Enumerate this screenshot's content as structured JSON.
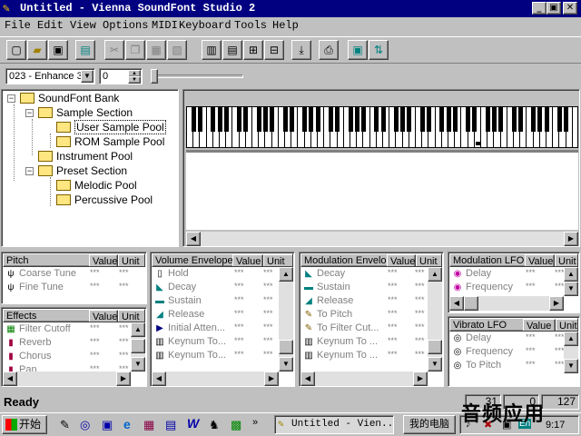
{
  "window": {
    "title": "Untitled - Vienna SoundFont Studio 2"
  },
  "menu": [
    "File",
    "Edit",
    "View",
    "Options",
    "MIDI",
    "Keyboard",
    "Tools",
    "Help"
  ],
  "controls": {
    "preset_select": "023 - Enhance 3",
    "bank_value": "0"
  },
  "tree": {
    "root": "SoundFont Bank",
    "sample_section": "Sample Section",
    "user_pool": "User Sample Pool",
    "rom_pool": "ROM Sample Pool",
    "instrument_pool": "Instrument Pool",
    "preset_section": "Preset Section",
    "melodic_pool": "Melodic Pool",
    "percussive_pool": "Percussive Pool"
  },
  "panels": {
    "pitch": {
      "title": "Pitch",
      "value": "Value",
      "unit": "Unit",
      "rows": [
        {
          "name": "Coarse Tune",
          "icon": "tuning-fork-icon",
          "value": "***",
          "unit": "***"
        },
        {
          "name": "Fine Tune",
          "icon": "tuning-fork-icon",
          "value": "***",
          "unit": "***"
        }
      ]
    },
    "effects": {
      "title": "Effects",
      "value": "Value",
      "unit": "Unit",
      "rows": [
        {
          "name": "Filter Cutoff",
          "icon": "filter-icon",
          "value": "***",
          "unit": "***"
        },
        {
          "name": "Reverb",
          "icon": "reverb-icon",
          "value": "***",
          "unit": "***"
        },
        {
          "name": "Chorus",
          "icon": "chorus-icon",
          "value": "***",
          "unit": "***"
        },
        {
          "name": "Pan",
          "icon": "pan-icon",
          "value": "***",
          "unit": "***"
        }
      ]
    },
    "volume_env": {
      "title": "Volume Envelope",
      "value": "Value",
      "unit": "Unit",
      "rows": [
        {
          "name": "Hold",
          "icon": "hold-icon",
          "value": "***",
          "unit": "***"
        },
        {
          "name": "Decay",
          "icon": "decay-icon",
          "value": "***",
          "unit": "***"
        },
        {
          "name": "Sustain",
          "icon": "sustain-icon",
          "value": "***",
          "unit": "***"
        },
        {
          "name": "Release",
          "icon": "release-icon",
          "value": "***",
          "unit": "***"
        },
        {
          "name": "Initial Atten...",
          "icon": "attenuation-icon",
          "value": "***",
          "unit": "***"
        },
        {
          "name": "Keynum To...",
          "icon": "keynum-icon",
          "value": "***",
          "unit": "***"
        },
        {
          "name": "Keynum To...",
          "icon": "keynum-icon",
          "value": "***",
          "unit": "***"
        }
      ]
    },
    "mod_env": {
      "title": "Modulation Envelo",
      "value": "Value",
      "unit": "Unit",
      "rows": [
        {
          "name": "Decay",
          "icon": "decay-icon",
          "value": "***",
          "unit": "***"
        },
        {
          "name": "Sustain",
          "icon": "sustain-icon",
          "value": "***",
          "unit": "***"
        },
        {
          "name": "Release",
          "icon": "release-icon",
          "value": "***",
          "unit": "***"
        },
        {
          "name": "To Pitch",
          "icon": "to-pitch-icon",
          "value": "***",
          "unit": "***"
        },
        {
          "name": "To Filter Cut...",
          "icon": "to-filter-icon",
          "value": "***",
          "unit": "***"
        },
        {
          "name": "Keynum To ...",
          "icon": "keynum-icon",
          "value": "***",
          "unit": "***"
        },
        {
          "name": "Keynum To ...",
          "icon": "keynum-icon",
          "value": "***",
          "unit": "***"
        }
      ]
    },
    "mod_lfo": {
      "title": "Modulation LFO",
      "value": "Value",
      "unit": "Unit",
      "rows": [
        {
          "name": "Delay",
          "icon": "lfo-icon",
          "value": "***",
          "unit": "***"
        },
        {
          "name": "Frequency",
          "icon": "lfo-icon",
          "value": "***",
          "unit": "***"
        }
      ]
    },
    "vib_lfo": {
      "title": "Vibrato LFO",
      "value": "Value",
      "unit": "Unit",
      "rows": [
        {
          "name": "Delay",
          "icon": "vibrato-icon",
          "value": "***",
          "unit": "***"
        },
        {
          "name": "Frequency",
          "icon": "vibrato-icon",
          "value": "***",
          "unit": "***"
        },
        {
          "name": "To Pitch",
          "icon": "vibrato-icon",
          "value": "***",
          "unit": "***"
        }
      ]
    }
  },
  "status": {
    "text": "Ready",
    "cells": [
      "31",
      "0",
      "127"
    ]
  },
  "taskbar": {
    "start": "开始",
    "task": "Untitled - Vien...",
    "computer": "我的电脑",
    "time": "9:17",
    "overlay": "音频应用"
  },
  "colors": {
    "title_bg": "#000080",
    "face": "#c0c0c0",
    "accent": "#008080"
  }
}
